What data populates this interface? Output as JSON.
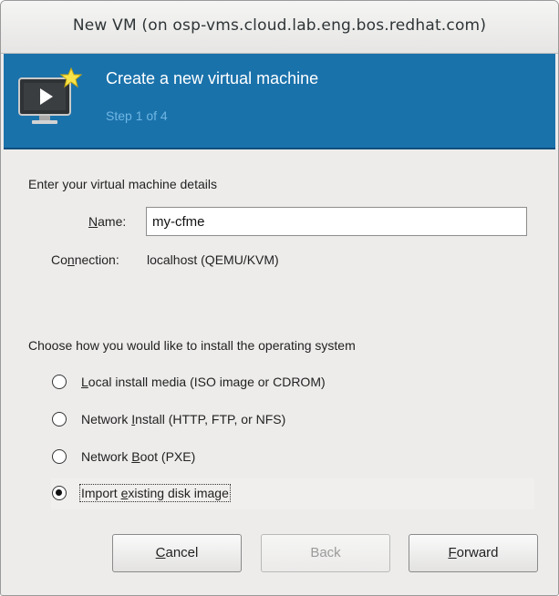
{
  "window": {
    "title": "New VM (on osp-vms.cloud.lab.eng.bos.redhat.com)"
  },
  "banner": {
    "heading": "Create a new virtual machine",
    "step": "Step 1 of 4",
    "icon": "monitor-play-star-icon"
  },
  "details": {
    "section_label": "Enter your virtual machine details",
    "name_label_accel": "N",
    "name_label_rest": "ame:",
    "name_value": "my-cfme",
    "connection_label_pre": "Co",
    "connection_label_accel": "n",
    "connection_label_post": "nection:",
    "connection_value": "localhost (QEMU/KVM)"
  },
  "install": {
    "section_label": "Choose how you would like to install the operating system",
    "options": [
      {
        "accel": "L",
        "rest": "ocal install media (ISO image or CDROM)",
        "pre": "",
        "selected": false
      },
      {
        "pre": "Network ",
        "accel": "I",
        "rest": "nstall (HTTP, FTP, or NFS)",
        "selected": false
      },
      {
        "pre": "Network ",
        "accel": "B",
        "rest": "oot (PXE)",
        "selected": false
      },
      {
        "pre": "Import ",
        "accel": "e",
        "rest": "xisting disk image",
        "selected": true
      }
    ]
  },
  "buttons": {
    "cancel_accel": "C",
    "cancel_rest": "ancel",
    "back": "Back",
    "forward_accel": "F",
    "forward_rest": "orward"
  },
  "colors": {
    "banner": "#1a72ab",
    "banner_step_text": "#6fb6e3",
    "window_bg": "#edeceb"
  }
}
